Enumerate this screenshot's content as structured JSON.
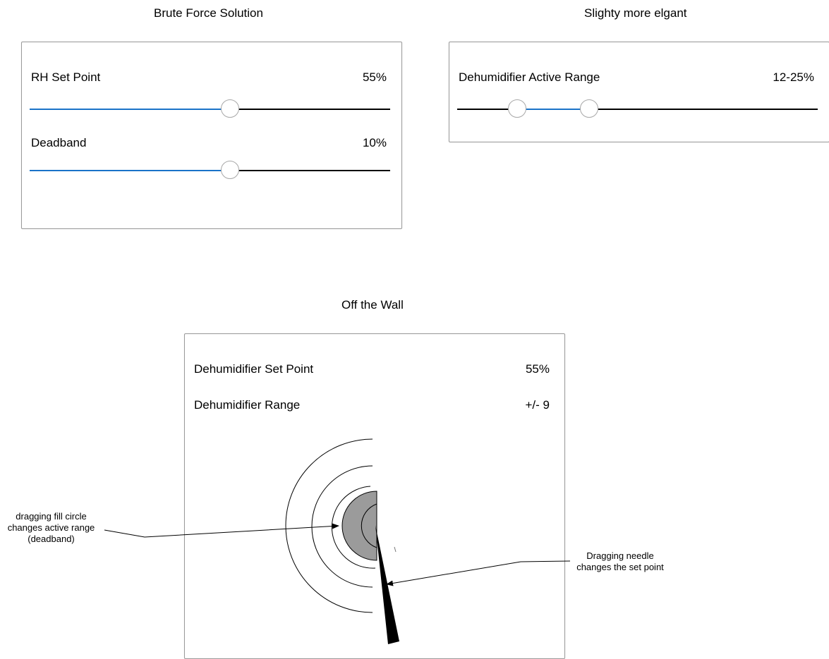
{
  "colors": {
    "accent": "#1a73c8",
    "track": "#000000",
    "dial_fill": "#9b9b9b"
  },
  "brute": {
    "title": "Brute Force Solution",
    "set_point": {
      "label": "RH Set Point",
      "value": "55%",
      "fraction": 0.555
    },
    "deadband": {
      "label": "Deadband",
      "value": "10%",
      "fraction": 0.555
    }
  },
  "elegant": {
    "title": "Slighty more elgant",
    "range": {
      "label": "Dehumidifier Active Range",
      "value": "12-25%",
      "low_fraction": 0.167,
      "high_fraction": 0.366
    }
  },
  "wall": {
    "title": "Off the Wall",
    "set_point": {
      "label": "Dehumidifier Set Point",
      "value": "55%"
    },
    "range": {
      "label": "Dehumidifier Range",
      "value": "+/- 9"
    }
  },
  "annotations": {
    "fill_circle": [
      "dragging fill circle",
      "changes active range",
      "(deadband)"
    ],
    "needle": [
      "Dragging needle",
      "changes the set point"
    ]
  }
}
